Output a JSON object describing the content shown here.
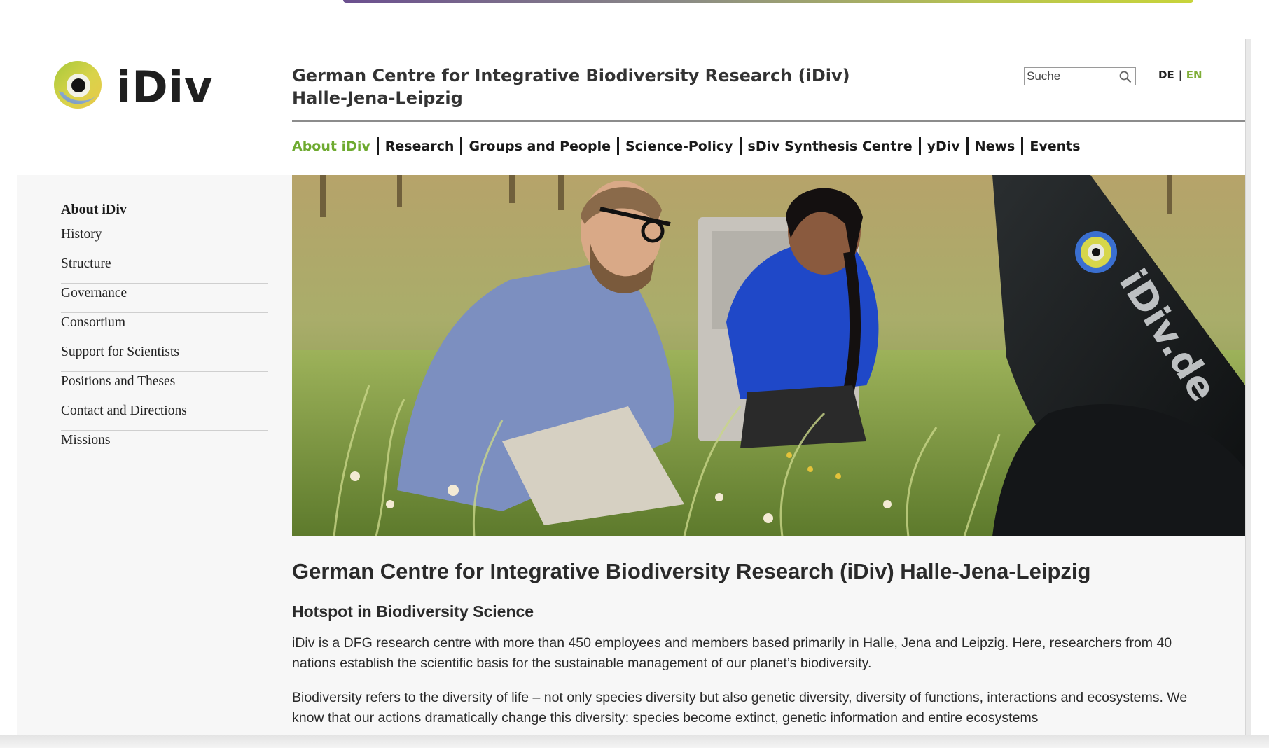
{
  "header": {
    "logo_text": "iDiv",
    "site_title_line1": "German Centre for Integrative Biodiversity Research (iDiv)",
    "site_title_line2": "Halle-Jena-Leipzig",
    "search": {
      "placeholder": "Suche",
      "icon": "magnifier-icon"
    },
    "languages": {
      "de": "DE",
      "separator": "|",
      "en": "EN",
      "active": "EN"
    }
  },
  "colors": {
    "accent_green": "#7fae38",
    "nav_active": "#6eaa30",
    "text_dark": "#222222",
    "background": "#f7f7f7"
  },
  "mainnav": {
    "items": [
      {
        "label": "About iDiv",
        "active": true
      },
      {
        "label": "Research",
        "active": false
      },
      {
        "label": "Groups and People",
        "active": false
      },
      {
        "label": "Science-Policy",
        "active": false
      },
      {
        "label": "sDiv Synthesis Centre",
        "active": false
      },
      {
        "label": "yDiv",
        "active": false
      },
      {
        "label": "News",
        "active": false
      },
      {
        "label": "Events",
        "active": false
      }
    ]
  },
  "sidebar": {
    "title": "About iDiv",
    "items": [
      {
        "label": "History"
      },
      {
        "label": "Structure"
      },
      {
        "label": "Governance"
      },
      {
        "label": "Consortium"
      },
      {
        "label": "Support for Scientists"
      },
      {
        "label": "Positions and Theses"
      },
      {
        "label": "Contact and Directions"
      },
      {
        "label": "Missions"
      }
    ]
  },
  "hero": {
    "bike_label": "iDiv.de"
  },
  "content": {
    "h1": "German Centre for Integrative Biodiversity Research (iDiv) Halle-Jena-Leipzig",
    "h2": "Hotspot in Biodiversity Science",
    "para1": "iDiv is a DFG research centre with more than 450 employees and members based primarily in Halle, Jena and Leipzig. Here, researchers from 40 nations establish the scientific basis for the sustainable management of our planet’s biodiversity.",
    "para2": "Biodiversity refers to the diversity of life – not only species diversity but also genetic diversity, diversity of functions, interactions and ecosystems. We know that our actions dramatically change this diversity: species become extinct, genetic information and entire ecosystems"
  }
}
